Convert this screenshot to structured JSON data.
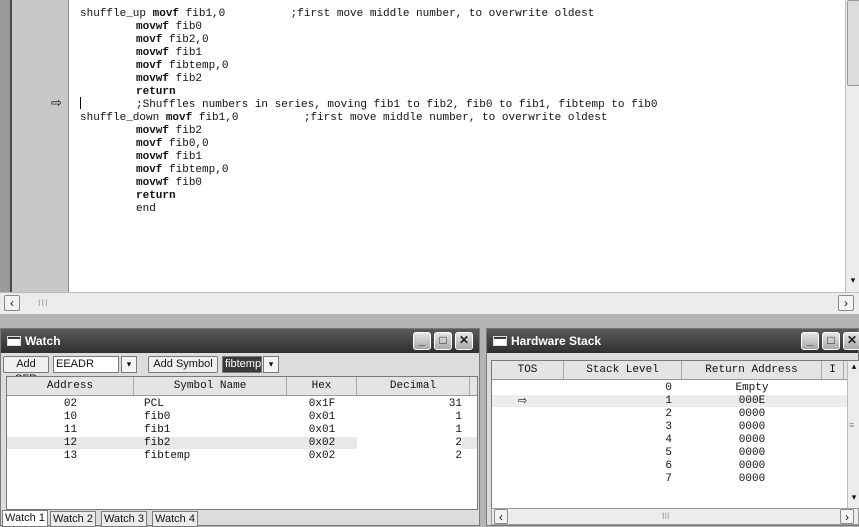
{
  "editor": {
    "lines": [
      {
        "label": "shuffle_up",
        "op": "movf",
        "args": "fib1,0",
        "comment": ";first move middle number, to overwrite oldest"
      },
      {
        "label": "",
        "op": "movwf",
        "args": "fib0",
        "comment": ""
      },
      {
        "label": "",
        "op": "movf",
        "args": "fib2,0",
        "comment": ""
      },
      {
        "label": "",
        "op": "movwf",
        "args": "fib1",
        "comment": ""
      },
      {
        "label": "",
        "op": "movf",
        "args": "fibtemp,0",
        "comment": ""
      },
      {
        "label": "",
        "op": "movwf",
        "args": "fib2",
        "comment": ""
      },
      {
        "label": "",
        "op": "return",
        "args": "",
        "comment": ""
      },
      {
        "label": "",
        "op": "",
        "args": "",
        "comment": ";Shuffles numbers in series, moving fib1 to fib2, fib0 to fib1, fibtemp to fib0"
      },
      {
        "label": "shuffle_down",
        "op": "movf",
        "args": "fib1,0",
        "comment": ";first move middle number, to overwrite oldest"
      },
      {
        "label": "",
        "op": "movwf",
        "args": "fib2",
        "comment": ""
      },
      {
        "label": "",
        "op": "movf",
        "args": "fib0,0",
        "comment": ""
      },
      {
        "label": "",
        "op": "movwf",
        "args": "fib1",
        "comment": ""
      },
      {
        "label": "",
        "op": "movf",
        "args": "fibtemp,0",
        "comment": ""
      },
      {
        "label": "",
        "op": "movwf",
        "args": "fib0",
        "comment": ""
      },
      {
        "label": "",
        "op": "return",
        "args": "",
        "comment": ""
      },
      {
        "label": "",
        "op": "",
        "args": "end",
        "comment": ""
      }
    ],
    "hscroll_grip": "III"
  },
  "watch": {
    "title": "Watch",
    "add_sfr_label": "Add SFR",
    "sfr_value": "EEADR",
    "add_symbol_label": "Add Symbol",
    "symbol_value": "fibtemp",
    "columns": [
      "Address",
      "Symbol Name",
      "Hex",
      "Decimal"
    ],
    "rows": [
      {
        "address": "02",
        "symbol": "PCL",
        "hex": "0x1F",
        "decimal": "31"
      },
      {
        "address": "10",
        "symbol": "fib0",
        "hex": "0x01",
        "decimal": "1"
      },
      {
        "address": "11",
        "symbol": "fib1",
        "hex": "0x01",
        "decimal": "1"
      },
      {
        "address": "12",
        "symbol": "fib2",
        "hex": "0x02",
        "decimal": "2"
      },
      {
        "address": "13",
        "symbol": "fibtemp",
        "hex": "0x02",
        "decimal": "2"
      }
    ],
    "tabs": [
      "Watch 1",
      "Watch 2",
      "Watch 3",
      "Watch 4"
    ],
    "active_tab": "Watch 1"
  },
  "stack": {
    "title": "Hardware Stack",
    "columns": [
      "TOS",
      "Stack Level",
      "Return Address",
      "I"
    ],
    "rows": [
      {
        "level": "0",
        "address": "Empty"
      },
      {
        "level": "1",
        "address": "000E"
      },
      {
        "level": "2",
        "address": "0000"
      },
      {
        "level": "3",
        "address": "0000"
      },
      {
        "level": "4",
        "address": "0000"
      },
      {
        "level": "5",
        "address": "0000"
      },
      {
        "level": "6",
        "address": "0000"
      },
      {
        "level": "7",
        "address": "0000"
      }
    ],
    "tos_level": "1",
    "hscroll_grip": "III"
  },
  "glyphs": {
    "arrow": "⇨",
    "dropdown": "▾",
    "left": "‹",
    "right": "›",
    "down": "▾",
    "up": "▴",
    "minimize": "_",
    "maximize": "□",
    "close": "✕",
    "grip": "≡"
  }
}
